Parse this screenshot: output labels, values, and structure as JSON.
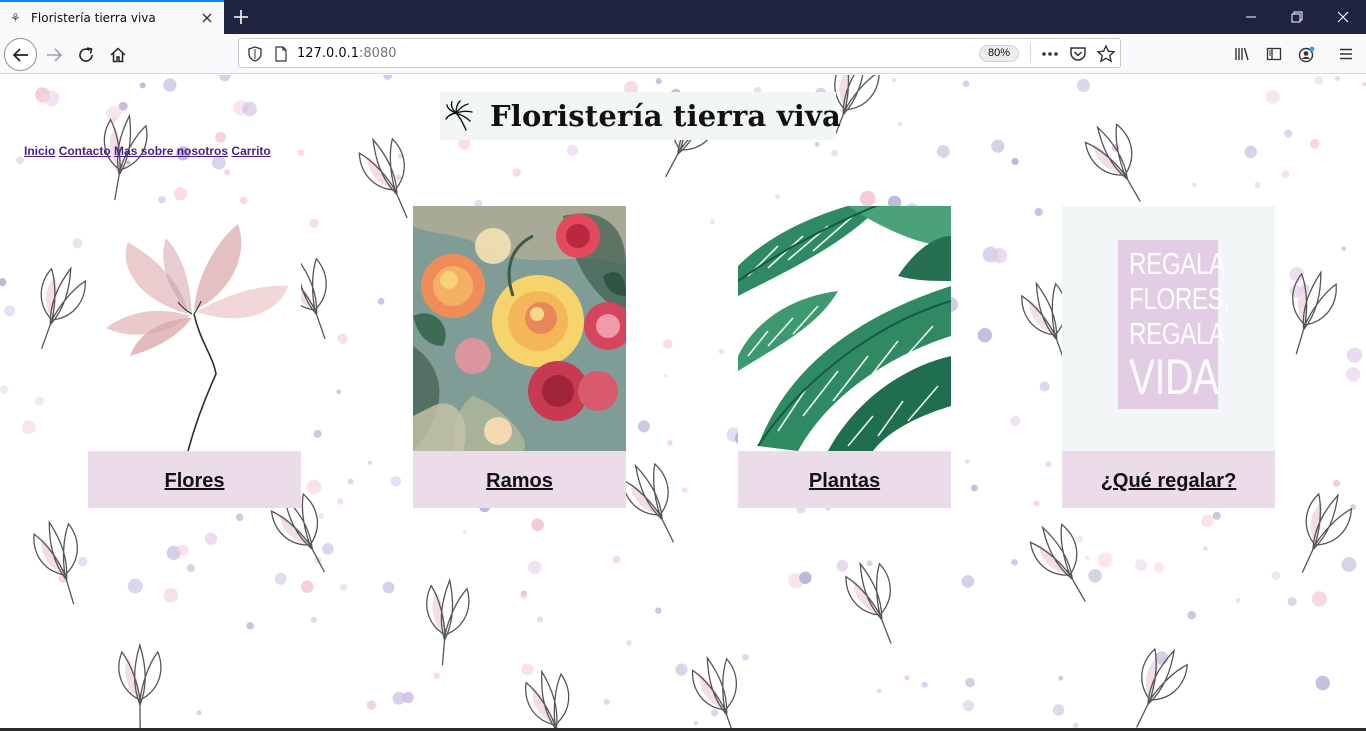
{
  "browser": {
    "tab_title": "Floristería tierra viva",
    "url_host": "127.0.0.1",
    "url_port": ":8080",
    "zoom": "80%"
  },
  "site": {
    "title": "Floristería tierra viva",
    "nav": [
      "Inicio",
      "Contacto",
      "Mas sobre nosotros",
      "Carrito"
    ]
  },
  "cards": [
    {
      "label": "Flores",
      "image": "watercolor-pink-flower"
    },
    {
      "label": "Ramos",
      "image": "watercolor-bouquet-roses"
    },
    {
      "label": "Plantas",
      "image": "watercolor-banana-leaves"
    },
    {
      "label": "¿Qué regalar?",
      "image": "gift-poster"
    }
  ],
  "gift_poster": {
    "line1": "REGALA",
    "line2": "FLORES,",
    "line3": "REGALA",
    "line4": "VIDA"
  },
  "colors": {
    "card_label_bg": "#ecdcea",
    "header_bg": "#f3f6f7",
    "nav_link": "#4b1f8a",
    "tab_accent": "#0a84ff",
    "titlebar": "#202340"
  }
}
